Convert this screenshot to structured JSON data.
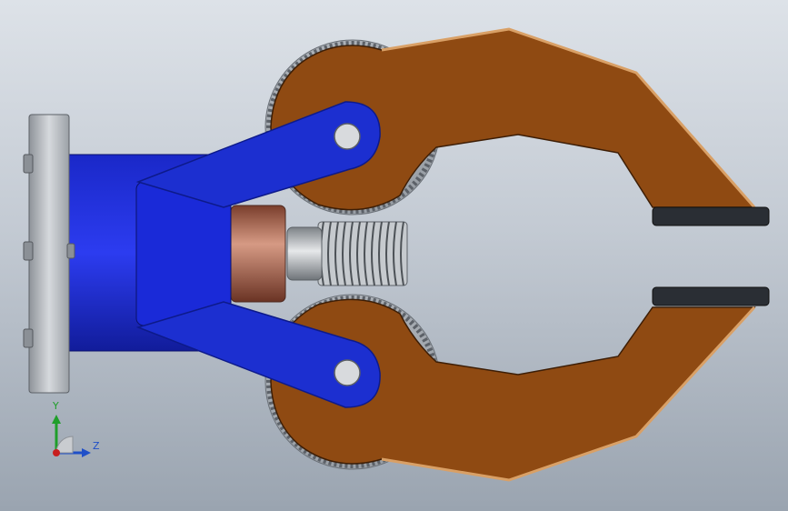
{
  "viewport": {
    "description_colors": {
      "jaw": "#8f4a12",
      "jaw_edge": "#d9a066",
      "link": "#1c2fd0",
      "link_dark": "#0d1a8a",
      "pad": "#2a2e34",
      "plate": "#b8bcc2"
    }
  },
  "triad": {
    "y_label": "Y",
    "z_label": "Z",
    "colors": {
      "y": "#1f9e2a",
      "z": "#2050c8",
      "x": "#c81e1e"
    }
  }
}
